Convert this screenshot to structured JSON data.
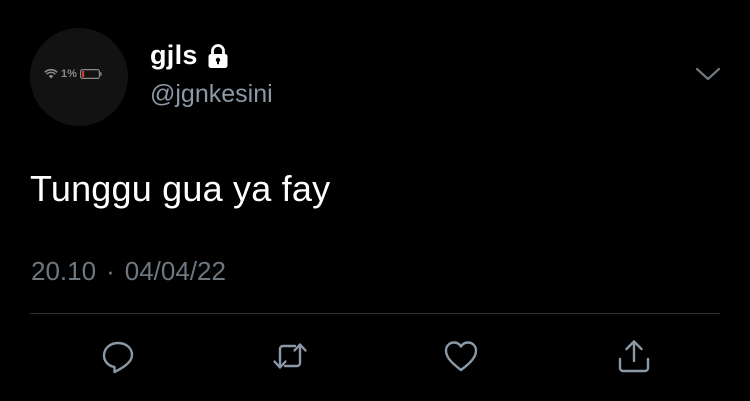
{
  "tweet": {
    "avatar": {
      "status_text": "1%",
      "wifi_icon": "wifi-icon",
      "battery_icon": "battery-low-icon",
      "battery_color": "#d23b2f"
    },
    "display_name": "gjls",
    "protected_icon": "lock-icon",
    "handle": "@jgnkesini",
    "more_icon": "chevron-down-icon",
    "text": "Tunggu gua ya fay",
    "time": "20.10",
    "separator": "·",
    "date": "04/04/22"
  },
  "actions": [
    {
      "name": "reply",
      "icon": "reply-icon"
    },
    {
      "name": "retweet",
      "icon": "retweet-icon"
    },
    {
      "name": "like",
      "icon": "heart-icon"
    },
    {
      "name": "share",
      "icon": "share-icon"
    }
  ],
  "colors": {
    "background": "#000000",
    "primary_text": "#ffffff",
    "secondary_text": "#8b98a5",
    "timestamp_text": "#6e7780",
    "icon": "#8b98a5",
    "divider": "#2f3336"
  }
}
